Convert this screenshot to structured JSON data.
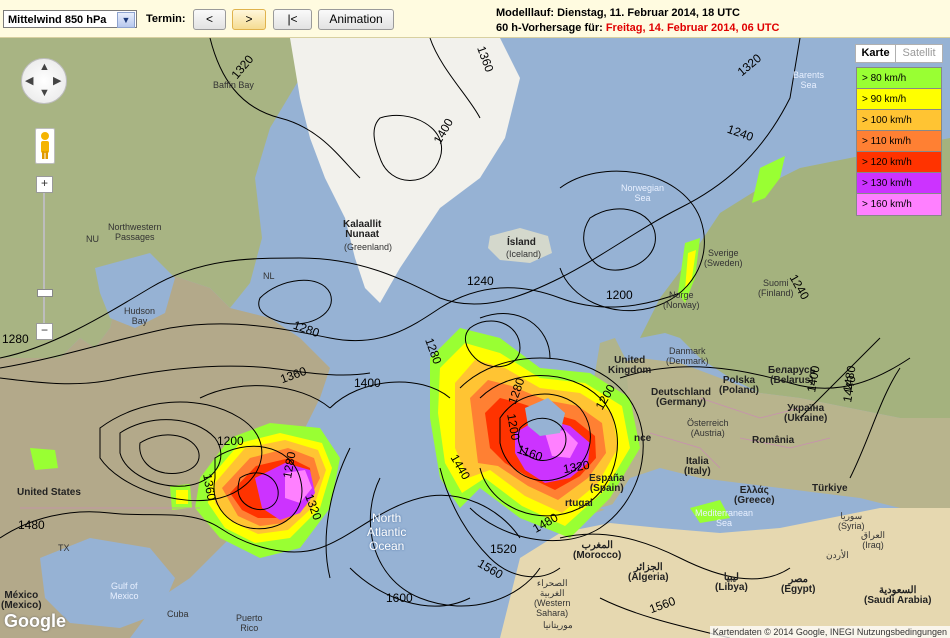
{
  "toolbar": {
    "level_select": "Mittelwind 850 hPa",
    "termin_label": "Termin:",
    "prev_label": "<",
    "next_label": ">",
    "first_label": "|<",
    "animation_label": "Animation",
    "run_text": "Modelllauf: Dienstag, 11. Februar 2014, 18 UTC",
    "forecast_prefix": "60 h-Vorhersage für: ",
    "forecast_date": "Freitag, 14. Februar 2014, 06 UTC"
  },
  "map_type": {
    "map": "Karte",
    "satellite": "Satellit"
  },
  "legend": [
    {
      "label": "> 80 km/h",
      "color": "#99ff33"
    },
    {
      "label": "> 90 km/h",
      "color": "#ffff00"
    },
    {
      "label": "> 100 km/h",
      "color": "#ffc433"
    },
    {
      "label": "> 110 km/h",
      "color": "#ff8033"
    },
    {
      "label": "> 120 km/h",
      "color": "#ff3300"
    },
    {
      "label": "> 130 km/h",
      "color": "#cc33ff"
    },
    {
      "label": "> 160 km/h",
      "color": "#ff80ff"
    }
  ],
  "places": {
    "baffin": "Baffin Bay",
    "nw_passages": "Northwestern\nPassages",
    "nu": "NU",
    "hudson": "Hudson\nBay",
    "nl": "NL",
    "kalaallit": "Kalaallit\nNunaat",
    "greenland": "(Greenland)",
    "island": "Ísland",
    "iceland": "(Iceland)",
    "norwegian": "Norwegian\nSea",
    "barents": "Barents\nSea",
    "sverige": "Sverige\n(Sweden)",
    "norge": "Norge\n(Norway)",
    "suomi": "Suomi\n(Finland)",
    "uk": "United\nKingdom",
    "danmark": "Danmark\n(Denmark)",
    "deutschland": "Deutschland\n(Germany)",
    "polska": "Polska\n(Poland)",
    "belarus": "Беларусь\n(Belarus)",
    "ukraine": "Україна\n(Ukraine)",
    "osterreich": "Österreich\n(Austria)",
    "romania": "România",
    "france": "nce",
    "italia": "Italia\n(Italy)",
    "ellas": "Ελλάς\n(Greece)",
    "turkiye": "Türkiye",
    "espana": "España\n(Spain)",
    "portugal": "rtugal",
    "med": "Mediterranean\nSea",
    "united_states": "United States",
    "tx": "TX",
    "gulf": "Gulf of\nMexico",
    "mexico": "México\n(Mexico)",
    "cuba": "Cuba",
    "puerto": "Puerto\nRico",
    "north_atlantic": "North\nAtlantic\nOcean",
    "morocco": "المغرب\n(Morocco)",
    "algeria": "الجزائر\n(Algeria)",
    "libya": "ليبيا\n(Libya)",
    "egypt": "مصر\n(Egypt)",
    "western_sahara": "الصحراء\nالغربية\n(Western\nSahara)",
    "mauritania": "موريتانيا",
    "syria": "سوريا\n(Syria)",
    "iraq": "العراق\n(Iraq)",
    "saudi": "السعودية\n(Saudi Arabia)",
    "jordan": "الأردن"
  },
  "isolines": [
    "1320",
    "1360",
    "1400",
    "1280",
    "1240",
    "1280",
    "1200",
    "1240",
    "1360",
    "1400",
    "1320",
    "1280",
    "1240",
    "1200",
    "1480",
    "1440",
    "1480",
    "1520",
    "1560",
    "1600",
    "1560",
    "1280",
    "1200",
    "1200",
    "1160",
    "1320",
    "1480",
    "1440",
    "1400",
    "1360",
    "1320",
    "1280"
  ],
  "map_footer": {
    "google": "Google",
    "copyright": "Kartendaten © 2014 Google, INEGI   Nutzungsbedingungen"
  }
}
